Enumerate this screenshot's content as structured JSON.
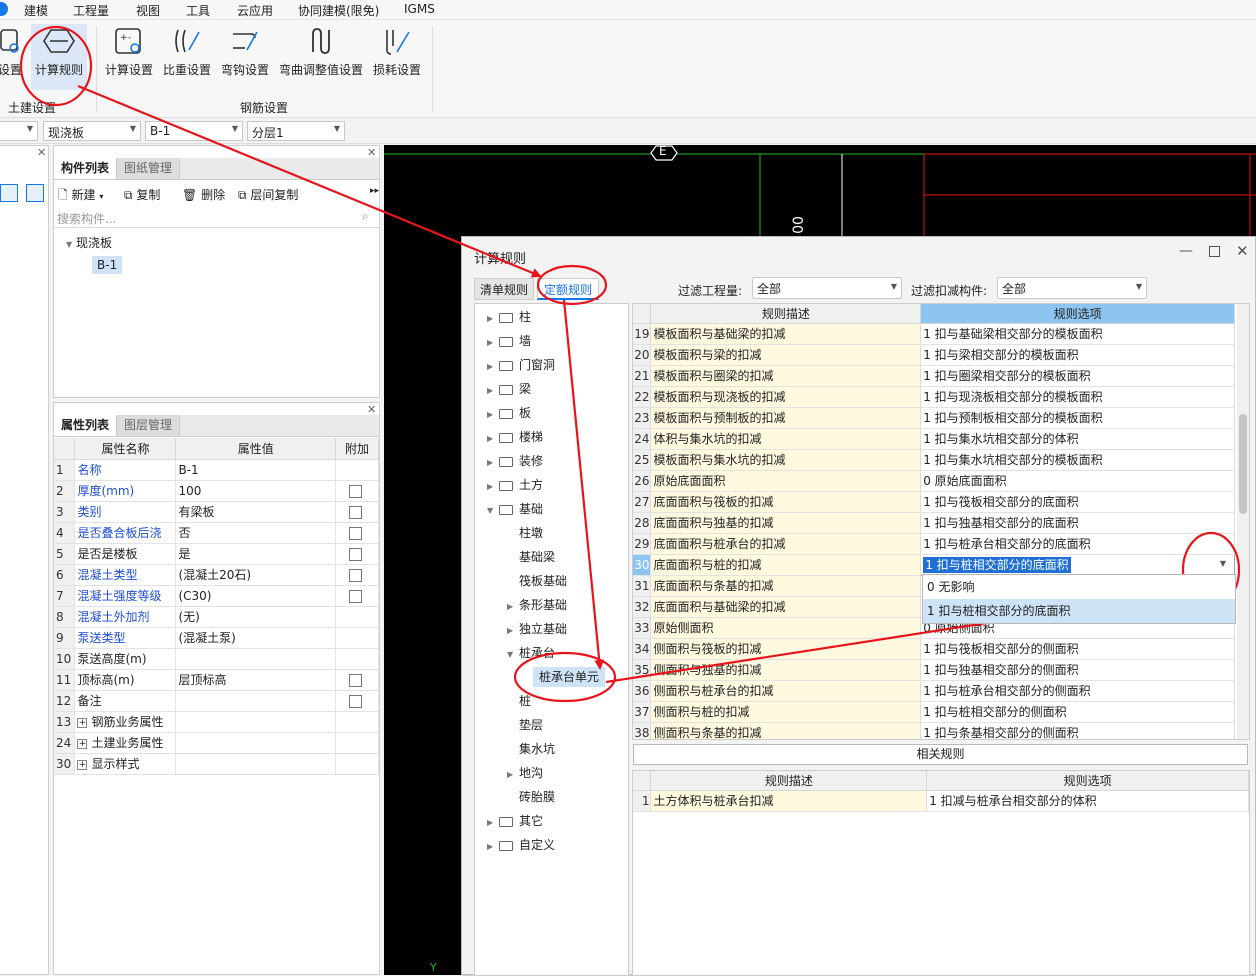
{
  "menu": [
    "建模",
    "工程量",
    "视图",
    "工具",
    "云应用",
    "协同建模(限免)",
    "IGMS"
  ],
  "ribbon": {
    "left_partial_label": "设置",
    "calc_rule_label": "计算规则",
    "buttons": [
      "计算设置",
      "比重设置",
      "弯钩设置",
      "弯曲调整值设置",
      "损耗设置"
    ],
    "group_civil": "土建设置",
    "group_rebar": "钢筋设置"
  },
  "combos": [
    "现浇板",
    "B-1",
    "分层1"
  ],
  "component_panel": {
    "tabs": [
      "构件列表",
      "图纸管理"
    ],
    "toolbar": [
      "新建",
      "复制",
      "删除",
      "层间复制"
    ],
    "search_placeholder": "搜索构件...",
    "tree_root": "现浇板",
    "tree_child": "B-1"
  },
  "property_panel": {
    "tabs": [
      "属性列表",
      "图层管理"
    ],
    "headers": [
      "属性名称",
      "属性值",
      "附加"
    ],
    "rows": [
      {
        "n": "1",
        "name": "名称",
        "value": "B-1",
        "blue": true,
        "cb": false
      },
      {
        "n": "2",
        "name": "厚度(mm)",
        "value": "100",
        "blue": true,
        "cb": true
      },
      {
        "n": "3",
        "name": "类别",
        "value": "有梁板",
        "blue": true,
        "cb": true
      },
      {
        "n": "4",
        "name": "是否叠合板后浇",
        "value": "否",
        "blue": true,
        "cb": true
      },
      {
        "n": "5",
        "name": "是否是楼板",
        "value": "是",
        "blue": false,
        "cb": true
      },
      {
        "n": "6",
        "name": "混凝土类型",
        "value": "(混凝土20石)",
        "blue": true,
        "cb": true
      },
      {
        "n": "7",
        "name": "混凝土强度等级",
        "value": "(C30)",
        "blue": true,
        "cb": true
      },
      {
        "n": "8",
        "name": "混凝土外加剂",
        "value": "(无)",
        "blue": true,
        "cb": false
      },
      {
        "n": "9",
        "name": "泵送类型",
        "value": "(混凝土泵)",
        "blue": true,
        "cb": false
      },
      {
        "n": "10",
        "name": "泵送高度(m)",
        "value": "",
        "blue": false,
        "cb": false
      },
      {
        "n": "11",
        "name": "顶标高(m)",
        "value": "层顶标高",
        "blue": false,
        "cb": true
      },
      {
        "n": "12",
        "name": "备注",
        "value": "",
        "blue": false,
        "cb": true
      },
      {
        "n": "13",
        "name": "钢筋业务属性",
        "value": "",
        "blue": false,
        "cb": false,
        "plus": true
      },
      {
        "n": "24",
        "name": "土建业务属性",
        "value": "",
        "blue": false,
        "cb": false,
        "plus": true
      },
      {
        "n": "30",
        "name": "显示样式",
        "value": "",
        "blue": false,
        "cb": false,
        "plus": true
      }
    ]
  },
  "cad": {
    "axis_label": "E",
    "vertical_text": "00",
    "bottom_mark": "Y"
  },
  "dialog": {
    "title": "计算规则",
    "tabs": [
      "清单规则",
      "定额规则"
    ],
    "filter_qty_label": "过滤工程量:",
    "filter_qty_value": "全部",
    "filter_deduct_label": "过滤扣减构件:",
    "filter_deduct_value": "全部",
    "tree_folders_top": [
      "柱",
      "墙",
      "门窗洞",
      "梁",
      "板",
      "楼梯",
      "装修",
      "土方"
    ],
    "tree_jichu": "基础",
    "tree_jichu_children": [
      "柱墩",
      "基础梁",
      "筏板基础",
      "条形基础",
      "独立基础",
      "桩承台"
    ],
    "tree_zhuchengtai_child": "桩承台单元",
    "tree_after": [
      "桩",
      "垫层",
      "集水坑",
      "地沟",
      "砖胎膜"
    ],
    "tree_folders_bottom": [
      "其它",
      "自定义"
    ],
    "grid_headers": [
      "规则描述",
      "规则选项"
    ],
    "rules": [
      {
        "n": "19",
        "d": "模板面积与基础梁的扣减",
        "o": "1 扣与基础梁相交部分的模板面积"
      },
      {
        "n": "20",
        "d": "模板面积与梁的扣减",
        "o": "1 扣与梁相交部分的模板面积"
      },
      {
        "n": "21",
        "d": "模板面积与圈梁的扣减",
        "o": "1 扣与圈梁相交部分的模板面积"
      },
      {
        "n": "22",
        "d": "模板面积与现浇板的扣减",
        "o": "1 扣与现浇板相交部分的模板面积"
      },
      {
        "n": "23",
        "d": "模板面积与预制板的扣减",
        "o": "1 扣与预制板相交部分的模板面积"
      },
      {
        "n": "24",
        "d": "体积与集水坑的扣减",
        "o": "1   扣与集水坑相交部分的体积"
      },
      {
        "n": "25",
        "d": "模板面积与集水坑的扣减",
        "o": "1   扣与集水坑相交部分的模板面积"
      },
      {
        "n": "26",
        "d": "原始底面面积",
        "o": "0 原始底面面积"
      },
      {
        "n": "27",
        "d": "底面面积与筏板的扣减",
        "o": "1 扣与筏板相交部分的底面积"
      },
      {
        "n": "28",
        "d": "底面面积与独基的扣减",
        "o": "1 扣与独基相交部分的底面积"
      },
      {
        "n": "29",
        "d": "底面面积与桩承台的扣减",
        "o": "1 扣与桩承台相交部分的底面积"
      },
      {
        "n": "30",
        "d": "底面面积与桩的扣减",
        "o": "1 扣与桩相交部分的底面积"
      },
      {
        "n": "31",
        "d": "底面面积与条基的扣减",
        "o": ""
      },
      {
        "n": "32",
        "d": "底面面积与基础梁的扣减",
        "o": ""
      },
      {
        "n": "33",
        "d": "原始侧面积",
        "o": "0 原始侧面积"
      },
      {
        "n": "34",
        "d": "侧面积与筏板的扣减",
        "o": "1 扣与筏板相交部分的侧面积"
      },
      {
        "n": "35",
        "d": "侧面积与独基的扣减",
        "o": "1 扣与独基相交部分的侧面积"
      },
      {
        "n": "36",
        "d": "侧面积与桩承台的扣减",
        "o": "1 扣与桩承台相交部分的侧面积"
      },
      {
        "n": "37",
        "d": "侧面积与桩的扣减",
        "o": "1 扣与桩相交部分的侧面积"
      },
      {
        "n": "38",
        "d": "侧面积与条基的扣减",
        "o": "1 扣与条基相交部分的侧面积"
      }
    ],
    "dropdown_options": [
      "0  无影响",
      "1 扣与桩相交部分的底面积"
    ],
    "related_rules_button": "相关规则",
    "related_headers": [
      "规则描述",
      "规则选项"
    ],
    "related_rows": [
      {
        "n": "1",
        "d": "土方体积与桩承台扣减",
        "o": "1 扣减与桩承台相交部分的体积"
      }
    ]
  },
  "colors": {
    "annotation_red": "#e8141b",
    "accent_blue": "#1677e8",
    "selected_row": "#cfe3f7",
    "highlight": "#1f6fd6"
  }
}
